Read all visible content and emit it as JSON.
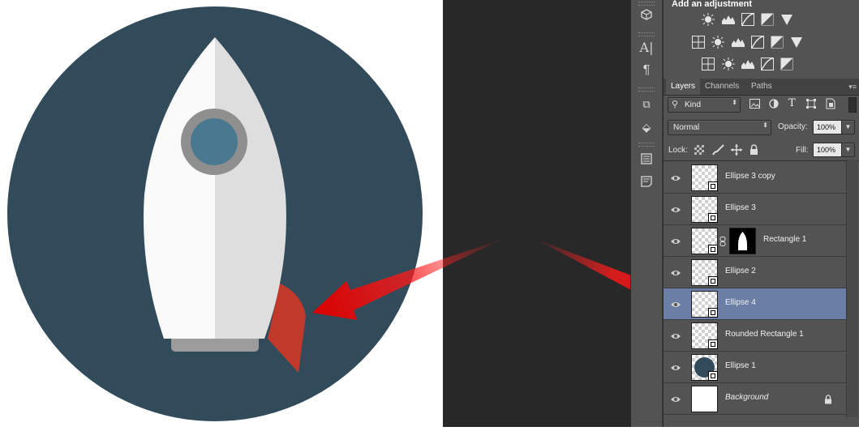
{
  "adjustments": {
    "title": "Add an adjustment",
    "icons": [
      "brightness-contrast-icon",
      "levels-icon",
      "curves-icon",
      "exposure-icon",
      "vibrance-icon",
      "hue-saturation-icon",
      "color-balance-icon",
      "black-white-icon",
      "photo-filter-icon",
      "channel-mixer-icon",
      "color-lookup-icon",
      "invert-icon",
      "posterize-icon",
      "threshold-icon",
      "selective-color-icon",
      "gradient-map-icon"
    ]
  },
  "tabs": {
    "layers": "Layers",
    "channels": "Channels",
    "paths": "Paths"
  },
  "filter": {
    "kind": "Kind"
  },
  "blend": {
    "mode": "Normal",
    "opacity_label": "Opacity:",
    "opacity_value": "100%"
  },
  "lock": {
    "label": "Lock:",
    "fill_label": "Fill:",
    "fill_value": "100%"
  },
  "layers": [
    {
      "name": "Ellipse 3 copy",
      "selected": false
    },
    {
      "name": "Ellipse 3",
      "selected": false
    },
    {
      "name": "Rectangle 1",
      "selected": false,
      "has_mask": true
    },
    {
      "name": "Ellipse 2",
      "selected": false
    },
    {
      "name": "Ellipse 4",
      "selected": true
    },
    {
      "name": "Rounded Rectangle 1",
      "selected": false
    },
    {
      "name": "Ellipse 1",
      "selected": false
    },
    {
      "name": "Background",
      "selected": false,
      "locked": true
    }
  ],
  "colors": {
    "circle": "#324b5a",
    "rocket_body_light": "#fafafa",
    "rocket_body_shade": "#dedede",
    "window_ring": "#8f8f8f",
    "window_glass": "#4a7890",
    "fin": "#c0392b",
    "base": "#9c9c9c",
    "arrow": "#e80c0c",
    "selected_row": "#6b7fa6"
  }
}
